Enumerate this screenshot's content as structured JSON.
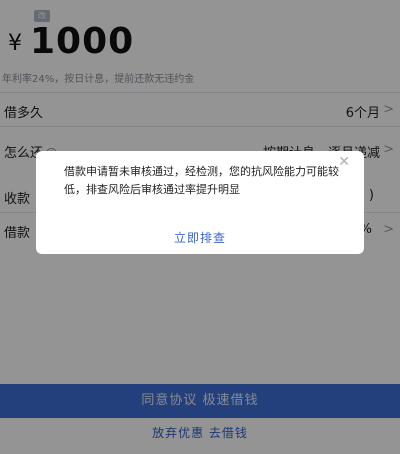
{
  "loan": {
    "currency_symbol": "¥",
    "amount": "1000",
    "edit_tag": "改",
    "rate_note": "年利率24%，按日计息，提前还款无违约金"
  },
  "rows": [
    {
      "label": "借多久",
      "value": "6个月",
      "arrow": ">"
    },
    {
      "label": "怎么还",
      "value": "按期计息，逐月递减",
      "arrow": ">",
      "info": "!"
    },
    {
      "label": "收款",
      "value": ")",
      "arrow": ""
    },
    {
      "label": "借款",
      "value": "%",
      "arrow": ">"
    }
  ],
  "footer": {
    "agree_button": "同意协议 极速借钱",
    "give_up_link": "放弃优惠 去借钱"
  },
  "dialog": {
    "message": "借款申请暂未审核通过，经检测，您的抗风险能力可能较低，排查风险后审核通过率提升明显",
    "action": "立即排查",
    "close": "✕"
  }
}
